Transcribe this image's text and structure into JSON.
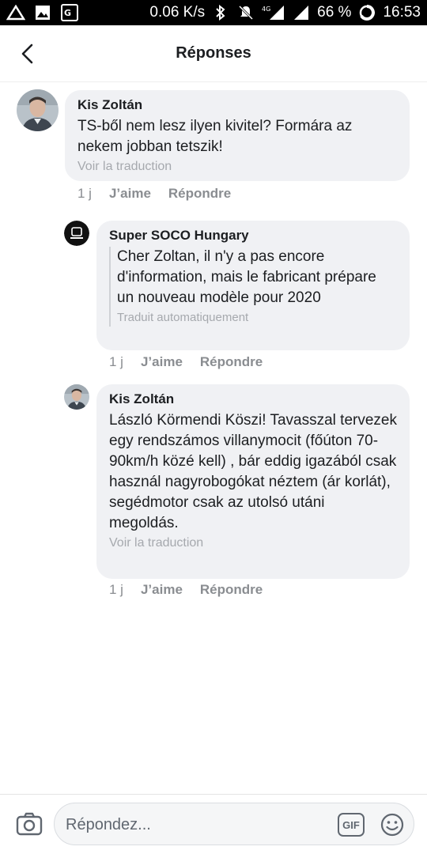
{
  "status_bar": {
    "speed": "0.06 K/s",
    "network": "4G",
    "battery": "66 %",
    "time": "16:53"
  },
  "header": {
    "title": "Réponses"
  },
  "comments": [
    {
      "author": "Kis Zoltán",
      "text": "TS-ből nem lesz ilyen kivitel? Formára az nekem jobban tetszik!",
      "translation_link": "Voir la traduction",
      "time": "1 j",
      "like": "J’aime",
      "reply": "Répondre"
    },
    {
      "author": "Super SOCO Hungary",
      "text": "Cher Zoltan, il n'y a pas encore d'information, mais le fabricant prépare un nouveau modèle pour 2020",
      "translation_note": "Traduit automatiquement",
      "time": "1 j",
      "like": "J’aime",
      "reply": "Répondre"
    },
    {
      "author": "Kis Zoltán",
      "text": "László Körmendi Köszi! Tavasszal tervezek egy rendszámos villanymocit (főúton 70-90km/h közé kell) , bár eddig igazából csak használ nagyrobogókat néztem (ár korlát), segédmotor csak az utolsó utáni megoldás.",
      "translation_link": "Voir la traduction",
      "time": "1 j",
      "like": "J’aime",
      "reply": "Répondre"
    }
  ],
  "composer": {
    "placeholder": "Répondez...",
    "gif_label": "GIF"
  }
}
